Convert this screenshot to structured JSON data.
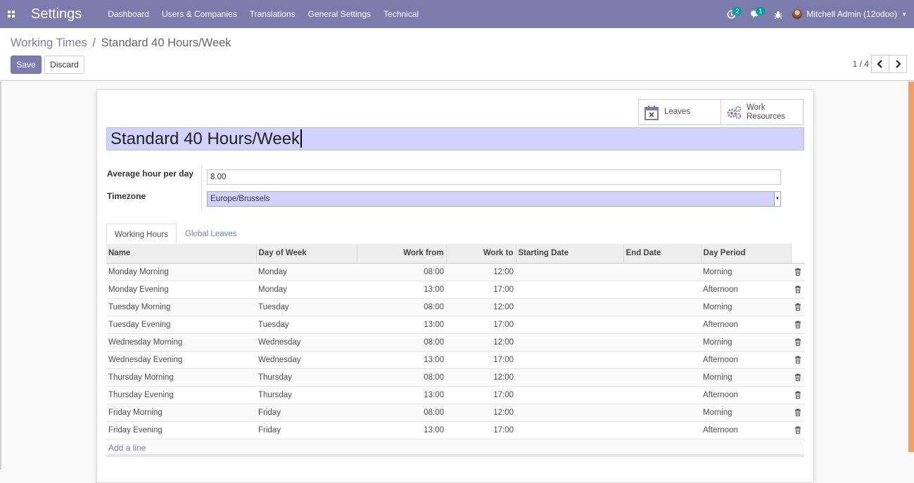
{
  "navbar": {
    "brand": "Settings",
    "menu": [
      "Dashboard",
      "Users & Companies",
      "Translations",
      "General Settings",
      "Technical"
    ],
    "activity_count": "2",
    "message_count": "1",
    "user": "Mitchell Admin (12odoo)"
  },
  "breadcrumb": {
    "parent": "Working Times",
    "separator": "/",
    "current": "Standard 40 Hours/Week"
  },
  "actions": {
    "save": "Save",
    "discard": "Discard"
  },
  "pager": {
    "value": "1 / 4"
  },
  "button_box": {
    "leaves": "Leaves",
    "work_resources_line1": "Work",
    "work_resources_line2": "Resources"
  },
  "record": {
    "name": "Standard 40 Hours/Week",
    "avg_hours_label": "Average hour per day",
    "avg_hours_value": "8.00",
    "timezone_label": "Timezone",
    "timezone_value": "Europe/Brussels"
  },
  "tabs": [
    {
      "label": "Working Hours",
      "active": true
    },
    {
      "label": "Global Leaves",
      "active": false
    }
  ],
  "table": {
    "columns": [
      "Name",
      "Day of Week",
      "Work from",
      "Work to",
      "Starting Date",
      "End Date",
      "Day Period"
    ],
    "rows": [
      [
        "Monday Morning",
        "Monday",
        "08:00",
        "12:00",
        "",
        "",
        "Morning"
      ],
      [
        "Monday Evening",
        "Monday",
        "13:00",
        "17:00",
        "",
        "",
        "Afternoon"
      ],
      [
        "Tuesday Morning",
        "Tuesday",
        "08:00",
        "12:00",
        "",
        "",
        "Morning"
      ],
      [
        "Tuesday Evening",
        "Tuesday",
        "13:00",
        "17:00",
        "",
        "",
        "Afternoon"
      ],
      [
        "Wednesday Morning",
        "Wednesday",
        "08:00",
        "12:00",
        "",
        "",
        "Morning"
      ],
      [
        "Wednesday Evening",
        "Wednesday",
        "13:00",
        "17:00",
        "",
        "",
        "Afternoon"
      ],
      [
        "Thursday Morning",
        "Thursday",
        "08:00",
        "12:00",
        "",
        "",
        "Morning"
      ],
      [
        "Thursday Evening",
        "Thursday",
        "13:00",
        "17:00",
        "",
        "",
        "Afternoon"
      ],
      [
        "Friday Morning",
        "Friday",
        "08:00",
        "12:00",
        "",
        "",
        "Morning"
      ],
      [
        "Friday Evening",
        "Friday",
        "13:00",
        "17:00",
        "",
        "",
        "Afternoon"
      ]
    ],
    "add_line": "Add a line"
  },
  "icons": {
    "apps": "apps-grid-icon",
    "activity": "clock-activity-icon",
    "messages": "chat-bubble-icon",
    "debug": "bug-icon",
    "leaves": "calendar-x-icon",
    "work_resources": "gears-icon",
    "delete": "trash-icon"
  },
  "colors": {
    "brand": "#7c7bad",
    "highlight_input": "#d2d2ff",
    "badge": "#00a09d"
  }
}
